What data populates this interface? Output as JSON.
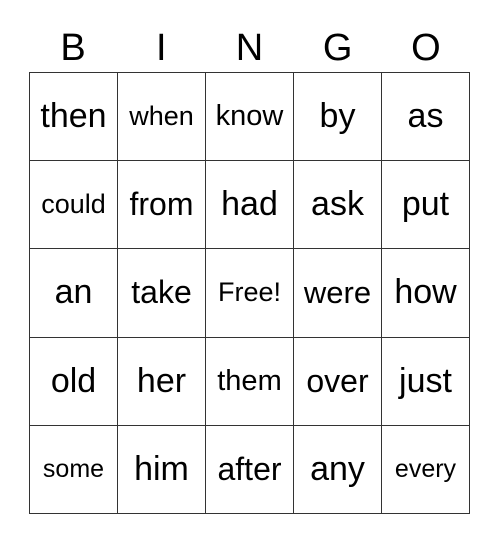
{
  "header": [
    "B",
    "I",
    "N",
    "G",
    "O"
  ],
  "cells": [
    [
      "then",
      "when",
      "know",
      "by",
      "as"
    ],
    [
      "could",
      "from",
      "had",
      "ask",
      "put"
    ],
    [
      "an",
      "take",
      "Free!",
      "were",
      "how"
    ],
    [
      "old",
      "her",
      "them",
      "over",
      "just"
    ],
    [
      "some",
      "him",
      "after",
      "any",
      "every"
    ]
  ]
}
